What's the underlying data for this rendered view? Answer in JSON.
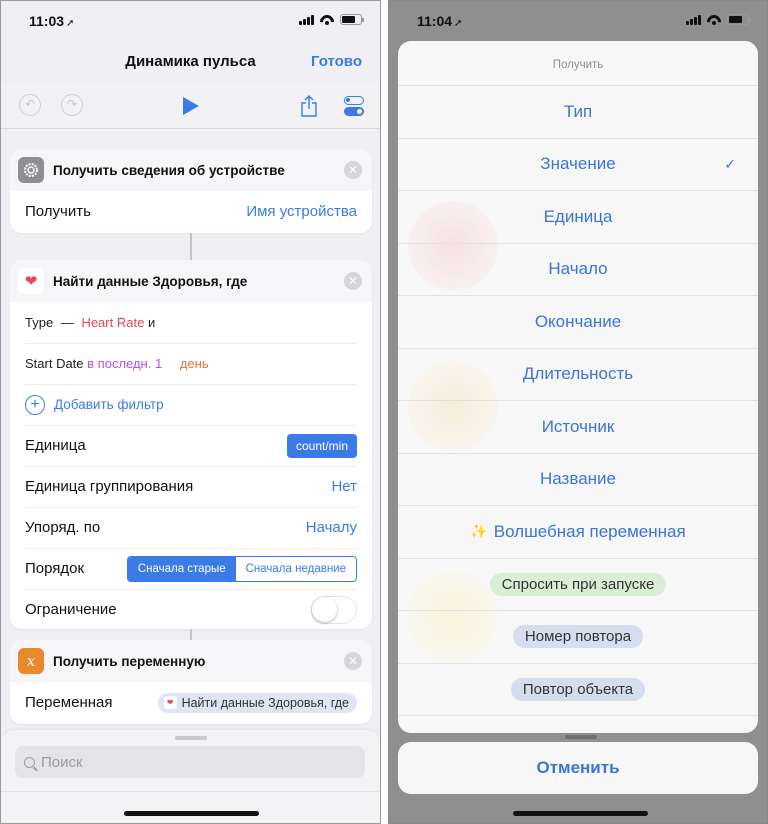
{
  "left_screen": {
    "status": {
      "time": "11:03"
    },
    "nav": {
      "title": "Динамика пульса",
      "done_label": "Готово"
    },
    "cards": {
      "device": {
        "title": "Получить сведения об устройстве",
        "row_label": "Получить",
        "row_value": "Имя устройства"
      },
      "health": {
        "title": "Найти данные Здоровья, где",
        "filter1": {
          "field": "Type",
          "op": "—",
          "value": "Heart Rate",
          "joiner": "и"
        },
        "filter2": {
          "field": "Start Date",
          "op": "в последн. 1",
          "unit": "день"
        },
        "add_filter_label": "Добавить фильтр",
        "unit_label": "Единица",
        "unit_value": "count/min",
        "group_label": "Единица группирования",
        "group_value": "Нет",
        "sort_label": "Упоряд. по",
        "sort_value": "Началу",
        "order_label": "Порядок",
        "order_options": [
          "Сначала старые",
          "Сначала недавние"
        ],
        "order_selected": "Сначала старые",
        "limit_label": "Ограничение",
        "limit_enabled": false
      },
      "variable": {
        "title": "Получить переменную",
        "icon_glyph": "x",
        "row_label": "Переменная",
        "row_value": "Найти данные Здоровья, где"
      }
    },
    "search": {
      "placeholder": "Поиск"
    }
  },
  "right_screen": {
    "status": {
      "time": "11:04"
    },
    "action_sheet": {
      "title": "Получить",
      "items": [
        {
          "label": "Тип",
          "selected": false
        },
        {
          "label": "Значение",
          "selected": true
        },
        {
          "label": "Единица",
          "selected": false
        },
        {
          "label": "Начало",
          "selected": false
        },
        {
          "label": "Окончание",
          "selected": false
        },
        {
          "label": "Длительность",
          "selected": false
        },
        {
          "label": "Источник",
          "selected": false
        },
        {
          "label": "Название",
          "selected": false
        }
      ],
      "magic_variable_label": "Волшебная переменная",
      "check_glyph": "✓",
      "special_variables": [
        {
          "label": "Спросить при запуске",
          "color": "#d8efd4"
        },
        {
          "label": "Номер повтора",
          "color": "#d5deee"
        },
        {
          "label": "Повтор объекта",
          "color": "#d5deee"
        }
      ],
      "cancel_label": "Отменить"
    }
  },
  "colors": {
    "accent": "#3b7be8",
    "health_red": "#e8445a",
    "variable_orange": "#e8892b",
    "settings_gray": "#8e8e93"
  }
}
